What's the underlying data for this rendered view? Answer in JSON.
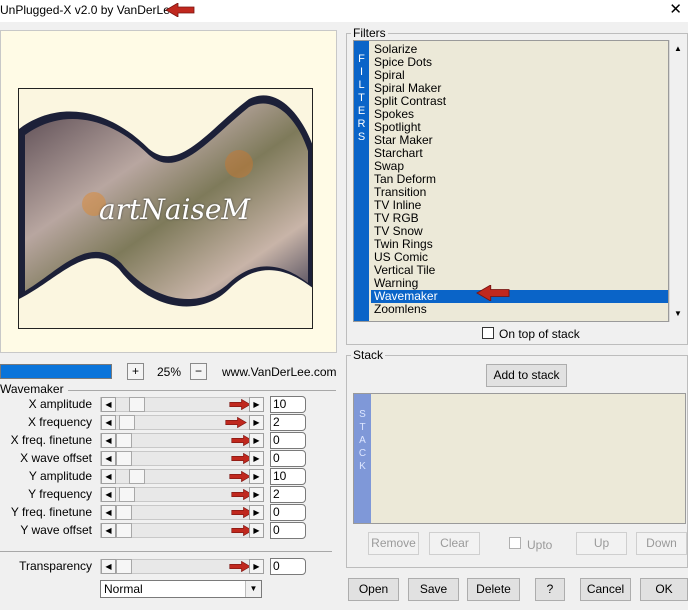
{
  "window": {
    "title": "UnPlugged-X v2.0 by VanDerLee",
    "close_glyph": "✕"
  },
  "preview": {
    "watermark": "artNaiseM"
  },
  "zoom": {
    "progress_percent": 100,
    "plus": "+",
    "value": "25%",
    "minus": "−",
    "website": "www.VanDerLee.com"
  },
  "params": {
    "title": "Wavemaker",
    "rows": [
      {
        "label": "X amplitude",
        "value": "10",
        "thumb_fraction": 0.1
      },
      {
        "label": "X frequency",
        "value": "2",
        "thumb_fraction": 0.02
      },
      {
        "label": "X freq. finetune",
        "value": "0",
        "thumb_fraction": 0
      },
      {
        "label": "X wave offset",
        "value": "0",
        "thumb_fraction": 0
      },
      {
        "label": "Y amplitude",
        "value": "10",
        "thumb_fraction": 0.1
      },
      {
        "label": "Y frequency",
        "value": "2",
        "thumb_fraction": 0.02
      },
      {
        "label": "Y freq. finetune",
        "value": "0",
        "thumb_fraction": 0
      },
      {
        "label": "Y wave offset",
        "value": "0",
        "thumb_fraction": 0
      }
    ],
    "transparency": {
      "label": "Transparency",
      "value": "0",
      "thumb_fraction": 0
    },
    "blend_mode": "Normal"
  },
  "filters": {
    "title": "Filters",
    "strip_letters": [
      "F",
      "I",
      "L",
      "T",
      "E",
      "R",
      "S"
    ],
    "items": [
      "Solarize",
      "Spice Dots",
      "Spiral",
      "Spiral Maker",
      "Split Contrast",
      "Spokes",
      "Spotlight",
      "Star Maker",
      "Starchart",
      "Swap",
      "Tan Deform",
      "Transition",
      "TV Inline",
      "TV RGB",
      "TV Snow",
      "Twin Rings",
      "US Comic",
      "Vertical Tile",
      "Warning",
      "Wavemaker",
      "Zoomlens"
    ],
    "selected_index": 19,
    "on_top_label": "On top of stack"
  },
  "stack": {
    "title": "Stack",
    "add_label": "Add to stack",
    "strip_letters": [
      "S",
      "T",
      "A",
      "C",
      "K"
    ],
    "remove_label": "Remove",
    "clear_label": "Clear",
    "upto_label": "Upto",
    "up_label": "Up",
    "down_label": "Down"
  },
  "footer": {
    "open": "Open",
    "save": "Save",
    "delete": "Delete",
    "help": "?",
    "cancel": "Cancel",
    "ok": "OK"
  },
  "colors": {
    "selection": "#0a64c8",
    "list_bg": "#ece9d8",
    "arrow_red": "#c0281e",
    "stack_strip": "#7f98d8"
  }
}
